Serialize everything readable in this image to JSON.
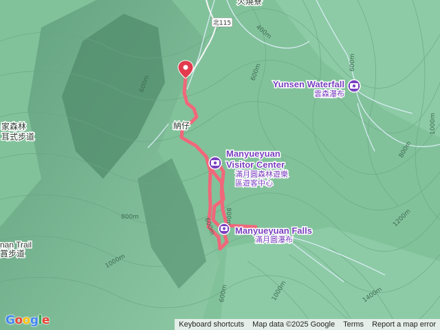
{
  "map": {
    "top_place": "火燒寮",
    "road_shield": "北115",
    "place_nazai": "納仔",
    "left_edge_labels": [
      "家森林",
      "耳式步道"
    ],
    "left_trail_labels": [
      "nan Trail",
      "賞步道"
    ],
    "contours": [
      "400m",
      "600m",
      "600m",
      "800m",
      "800m",
      "1000m",
      "1000m",
      "600m",
      "800m",
      "1200m",
      "1400m",
      "1000m",
      "600m",
      "600m"
    ],
    "colors": {
      "terrain": "#7fbf98",
      "route": "#f0687a",
      "poi": "#7a3fbf",
      "water": "#d8ecf4"
    }
  },
  "pois": {
    "yunsen": {
      "name": "Yunsen Waterfall",
      "local": "雲森瀑布",
      "icon": "camera-icon"
    },
    "visitor_center": {
      "name_line1": "Manyueyuan",
      "name_line2": "Visitor Center",
      "local_line1": "滿月圓森林遊樂",
      "local_line2": "區遊客中心",
      "icon": "camera-icon"
    },
    "falls": {
      "name": "Manyueyuan Falls",
      "local": "滿月圓瀑布",
      "icon": "camera-icon"
    }
  },
  "footer": {
    "shortcuts": "Keyboard shortcuts",
    "map_data": "Map data ©2025 Google",
    "terms": "Terms",
    "report": "Report a map error"
  },
  "logo": "Google"
}
